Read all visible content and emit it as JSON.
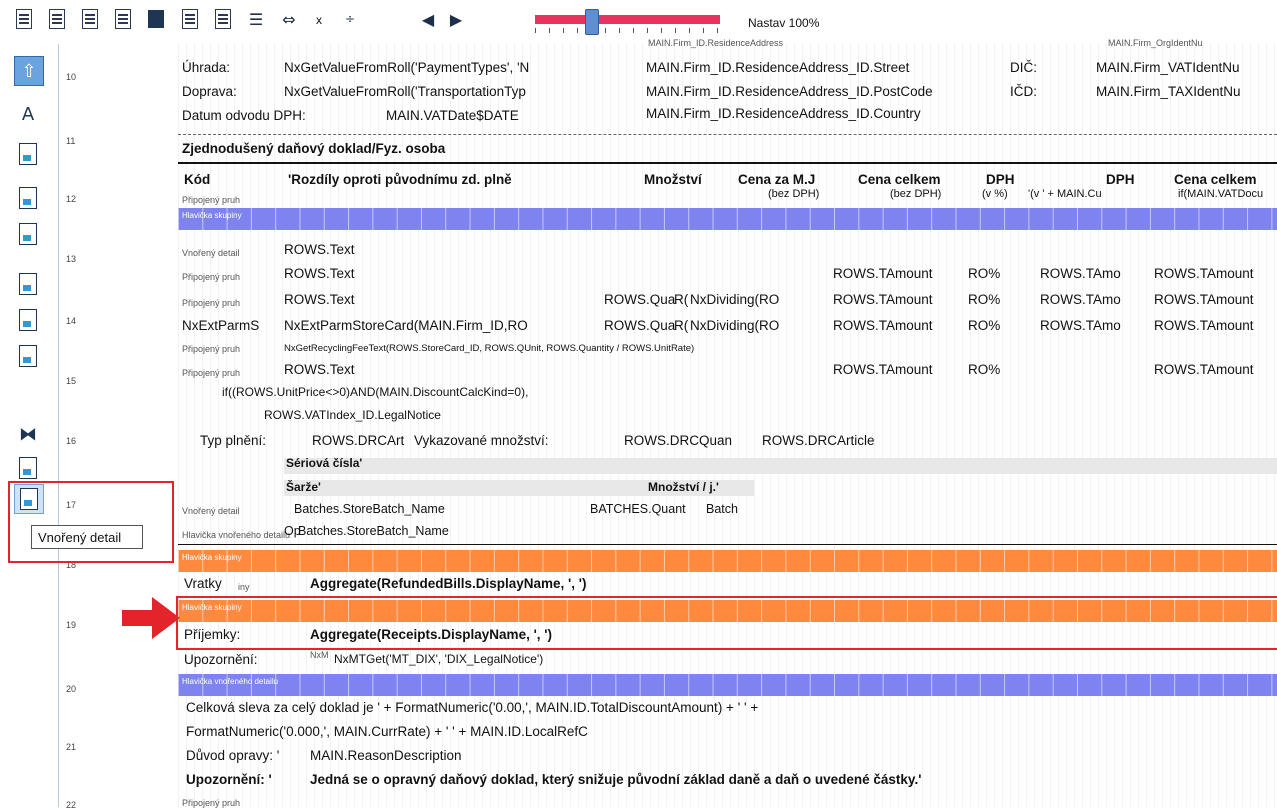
{
  "toolbar": {
    "zoom_label": "Nastav 100%",
    "x_label": "x",
    "icons": [
      "print-preview-icon",
      "import-icon",
      "print-icon",
      "export-icon",
      "bookmark-icon",
      "chart-icon",
      "copy-icon",
      "align-icon",
      "move-icon",
      "formula-icon",
      "prev-icon",
      "next-icon"
    ]
  },
  "left_tools": {
    "tooltip": "Vnořený detail",
    "icons": [
      "arrow-up-icon",
      "text-a-icon",
      "formula-emc-icon",
      "report-a-icon",
      "report-b-icon",
      "sys-icon",
      "arrows-icon",
      "field-icon",
      "link-icon",
      "grid-icon",
      "nested-detail-icon"
    ]
  },
  "bands": {
    "numbers": [
      "10",
      "11",
      "12",
      "13",
      "14",
      "15",
      "16",
      "17",
      "18",
      "19",
      "20",
      "21",
      "22"
    ]
  },
  "canvas": {
    "uhrada_label": "Úhrada:",
    "uhrada_expr": "NxGetValueFromRoll('PaymentTypes', 'N",
    "street": "MAIN.Firm_ID.ResidenceAddress_ID.Street",
    "dic_label": "DIČ:",
    "vat_ident": "MAIN.Firm_VATIdentNu",
    "doprava_label": "Doprava:",
    "doprava_expr": "NxGetValueFromRoll('TransportationTyp",
    "postcode": "MAIN.Firm_ID.ResidenceAddress_ID.PostCode",
    "icd_label": "IČD:",
    "tax_ident": "MAIN.Firm_TAXIdentNu",
    "datum_label": "Datum odvodu DPH:",
    "vat_date": "MAIN.VATDate$DATE",
    "country": "MAIN.Firm_ID.ResidenceAddress_ID.Country",
    "title": "Zjednodušený daňový doklad/Fyz. osoba",
    "col_kod": "Kód",
    "col_rozdily": "'Rozdíly oproti původnímu zd. plně",
    "col_mnozstvi": "Množství",
    "col_cena_mj": "Cena za M.J",
    "col_cena_mj_sub": "(bez DPH)",
    "col_cena_celkem": "Cena celkem",
    "col_cena_celkem_sub": "(bez DPH)",
    "col_dph": "DPH",
    "col_dph_sub": "(v %)",
    "col_dph2": "DPH",
    "col_dph2_sub": "'(v ' + MAIN.Cu",
    "col_cena_celkem2": "Cena celkem",
    "col_cena_celkem2_sub": "if(MAIN.VATDocu",
    "pripojeny_pruh": "Připojený pruh",
    "hlavicka_skupiny": "Hlavička skupiny",
    "vnoreny_detail": "Vnořený detail",
    "rows_text": "ROWS.Text",
    "rows_tamount": "ROWS.TAmount",
    "ro_pct": "RO%",
    "rows_tamo": "ROWS.TAmo",
    "rows_qua": "ROWS.Qua",
    "r_small": "R(",
    "nx_dividing": "NxDividing(RO",
    "nx_ext_parms": "NxExtParmS",
    "nx_ext_store": "NxExtParmStoreCard(MAIN.Firm_ID,RO",
    "recycling": "NxGetRecyclingFeeText(ROWS.StoreCard_ID, ROWS.QUnit, ROWS.Quantity / ROWS.UnitRate)",
    "if_unitprice": "if((ROWS.UnitPrice<>0)AND(MAIN.DiscountCalcKind=0),",
    "vat_legal": "ROWS.VATIndex_ID.LegalNotice",
    "typ_plneni": "Typ plnění:",
    "drc_art": "ROWS.DRCArt",
    "vykaz": "Vykazované množství:",
    "drc_quan": "ROWS.DRCQuan",
    "drc_article": "ROWS.DRCArticle",
    "seriova": "Sériová čísla'",
    "sarze": "Šarže'",
    "mnozstvi_j": "Množství / j.'",
    "batch_name": "Batches.StoreBatch_Name",
    "batches_quant": "BATCHES.Quant",
    "batch_short": "Batch",
    "hlavicka_vnoreneho": "Hlavička vnořeného detailu",
    "op": "Op",
    "vratky": "Vratky",
    "iny": "iny",
    "refunded": "Aggregate(RefundedBills.DisplayName, ', ')",
    "prijemky": "Příjemky:",
    "receipts": "Aggregate(Receipts.DisplayName, ', ')",
    "upozorneni": "Upozornění:",
    "nxm": "NxM",
    "mt_get": "NxMTGet('MT_DIX', 'DIX_LegalNotice')",
    "celkova_sleva": "Celková sleva za celý doklad je ' + FormatNumeric('0.00,', MAIN.ID.TotalDiscountAmount) + ' ' +",
    "format_rate": "FormatNumeric('0.000,', MAIN.CurrRate) + ' ' + MAIN.ID.LocalRefC",
    "duvod": "Důvod opravy: '",
    "reason": "MAIN.ReasonDescription",
    "upozorneni2": "Upozornění: '",
    "opravny": "Jedná se o opravný daňový doklad, který snižuje původní základ daně a daň o uvedené částky.'",
    "top_cut1": "MAIN.Firm_ID.ResidenceAddress",
    "top_cut2": "MAIN.Firm_OrgIdentNu"
  },
  "colors": {
    "blue_band": "#7f83f0",
    "orange_band": "#ff8a3d",
    "annotation_red": "#e3242b"
  }
}
